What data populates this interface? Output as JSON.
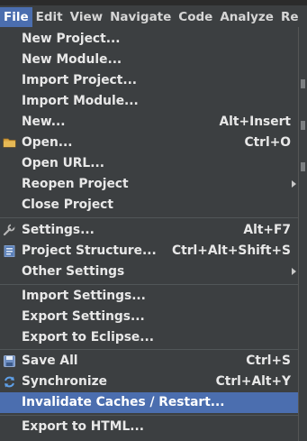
{
  "menubar": {
    "items": [
      {
        "label": "File"
      },
      {
        "label": "Edit"
      },
      {
        "label": "View"
      },
      {
        "label": "Navigate"
      },
      {
        "label": "Code"
      },
      {
        "label": "Analyze"
      },
      {
        "label": "Re"
      }
    ]
  },
  "file_menu": {
    "items": [
      {
        "label": "New Project..."
      },
      {
        "label": "New Module..."
      },
      {
        "label": "Import Project..."
      },
      {
        "label": "Import Module..."
      },
      {
        "label": "New...",
        "shortcut": "Alt+Insert"
      },
      {
        "label": "Open...",
        "shortcut": "Ctrl+O",
        "icon": "folder-icon"
      },
      {
        "label": "Open URL..."
      },
      {
        "label": "Reopen Project",
        "submenu": true
      },
      {
        "label": "Close Project"
      },
      {
        "label": "Settings...",
        "shortcut": "Alt+F7",
        "icon": "settings-icon"
      },
      {
        "label": "Project Structure...",
        "shortcut": "Ctrl+Alt+Shift+S",
        "icon": "project-structure-icon"
      },
      {
        "label": "Other Settings",
        "submenu": true
      },
      {
        "label": "Import Settings..."
      },
      {
        "label": "Export Settings..."
      },
      {
        "label": "Export to Eclipse..."
      },
      {
        "label": "Save All",
        "shortcut": "Ctrl+S",
        "icon": "save-icon"
      },
      {
        "label": "Synchronize",
        "shortcut": "Ctrl+Alt+Y",
        "icon": "sync-icon"
      },
      {
        "label": "Invalidate Caches / Restart...",
        "highlighted": true
      },
      {
        "label": "Export to HTML..."
      }
    ]
  },
  "colors": {
    "menu_background": "#3c3f41",
    "highlight": "#4b6eaf",
    "text": "#e8e8e8",
    "separator": "#515658"
  }
}
